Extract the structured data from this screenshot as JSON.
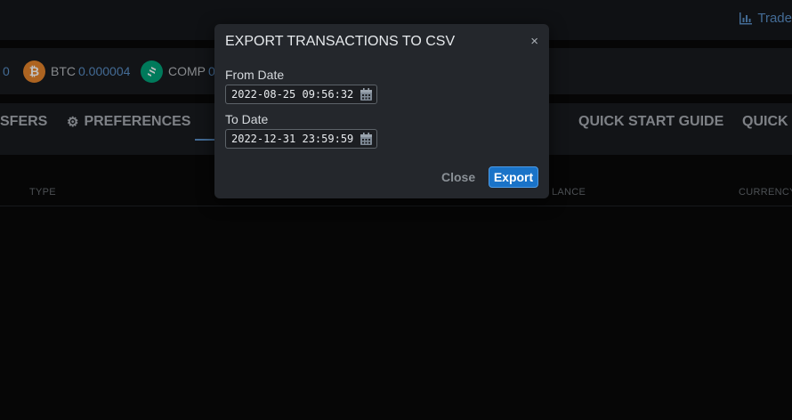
{
  "topbar": {
    "trade_label": "Trade",
    "trade_icon": "chart-bar-icon"
  },
  "balances": [
    {
      "symbol": "",
      "amount": "0"
    },
    {
      "symbol": "BTC",
      "amount": "0.000004",
      "icon": "bitcoin-icon",
      "color": "#e7862c"
    },
    {
      "symbol": "COMP",
      "amount": "0",
      "icon": "compound-icon",
      "color": "#00a37a"
    }
  ],
  "nav": {
    "transfers": "SFERS",
    "preferences": "PREFERENCES",
    "quick_start": "QUICK START GUIDE",
    "quick_t": "QUICK T"
  },
  "table": {
    "headers": [
      "TYPE",
      "LANCE",
      "CURRENCY"
    ]
  },
  "modal": {
    "title": "EXPORT TRANSACTIONS TO CSV",
    "close_x": "×",
    "from_label": "From Date",
    "from_value": "2022-08-25 09:56:32",
    "to_label": "To Date",
    "to_value": "2022-12-31 23:59:59",
    "close_button": "Close",
    "export_button": "Export"
  },
  "colors": {
    "accent": "#1a73c8",
    "link": "#5a8fc7"
  }
}
